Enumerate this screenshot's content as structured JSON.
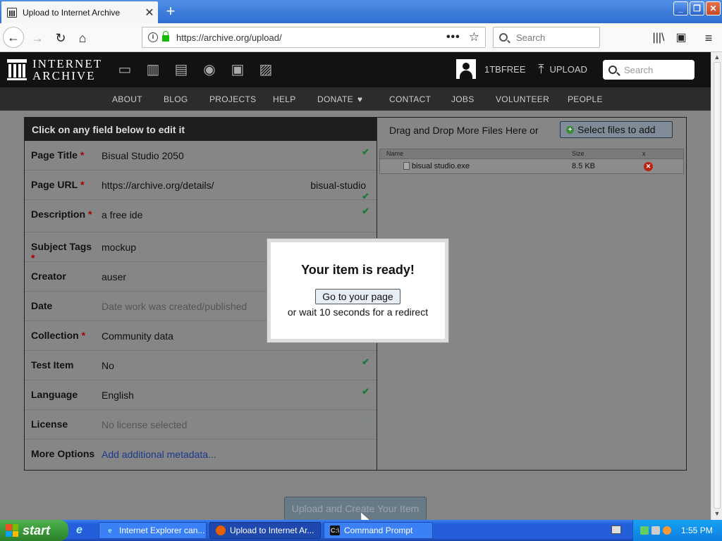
{
  "browser": {
    "tab_title": "Upload to Internet Archive",
    "tab_close": "✕",
    "new_tab": "+",
    "url": "https://archive.org/upload/",
    "url_more": "•••",
    "search_placeholder": "Search",
    "window_buttons": [
      "_",
      "❐",
      "✕"
    ]
  },
  "ia": {
    "logo_line1": "INTERNET",
    "logo_line2": "ARCHIVE",
    "user_name": "1TBFREE",
    "upload_label": "UPLOAD",
    "search_placeholder": "Search",
    "nav": [
      "ABOUT",
      "BLOG",
      "PROJECTS",
      "HELP",
      "DONATE",
      "CONTACT",
      "JOBS",
      "VOLUNTEER",
      "PEOPLE"
    ]
  },
  "form": {
    "header": "Click on any field below to edit it",
    "rows": [
      {
        "label": "Page Title",
        "value": "Bisual Studio 2050"
      },
      {
        "label": "Page URL",
        "value": "https://archive.org/details/",
        "extra": "bisual-studio"
      },
      {
        "label": "Description",
        "value": "a free ide"
      },
      {
        "label": "Subject Tags",
        "value": "mockup"
      },
      {
        "label": "Creator",
        "value": "auser"
      },
      {
        "label": "Date",
        "value": "Date work was created/published"
      },
      {
        "label": "Collection",
        "value": "Community data"
      },
      {
        "label": "Test Item",
        "value": "No"
      },
      {
        "label": "Language",
        "value": "English"
      },
      {
        "label": "License",
        "value": "No license selected"
      },
      {
        "label": "More Options",
        "value": "Add additional metadata..."
      }
    ],
    "required_mark": "*"
  },
  "files": {
    "drag_text": "Drag and Drop More Files Here or",
    "select_button": "Select files to add",
    "columns": [
      "Name",
      "Size",
      "x"
    ],
    "rows": [
      {
        "name": "bisual studio.exe",
        "size": "8.5 KB"
      }
    ]
  },
  "upload_button": "Upload and Create Your Item",
  "modal": {
    "title": "Your item is ready!",
    "button": "Go to your page",
    "wait_text": "or wait 10 seconds for a redirect"
  },
  "taskbar": {
    "start": "start",
    "tasks": [
      "Internet Explorer can...",
      "Upload to Internet Ar...",
      "Command Prompt"
    ],
    "clock": "1:55 PM"
  }
}
